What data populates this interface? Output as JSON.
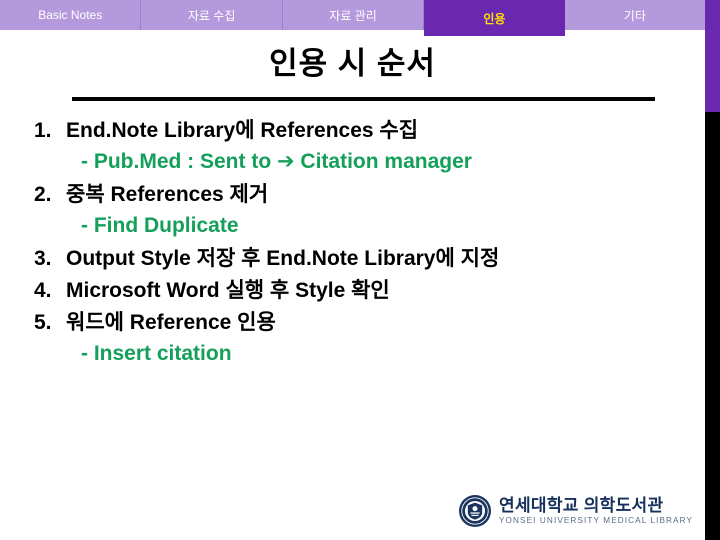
{
  "navbar": {
    "tabs": [
      {
        "label": "Basic Notes",
        "active": false
      },
      {
        "label": "자료 수집",
        "active": false
      },
      {
        "label": "자료 관리",
        "active": false
      },
      {
        "label": "인용",
        "active": true
      },
      {
        "label": "기타",
        "active": false
      }
    ],
    "background_color": "#b49add",
    "active_background_color": "#6a28b0",
    "active_text_color": "#ffe000",
    "text_color": "#ffffff"
  },
  "title": {
    "text": "인용 시 순서"
  },
  "content": {
    "items": [
      {
        "number": "1.",
        "text": "End.Note Library에 References 수집",
        "sub": "- Pub.Med : Sent to ➔ Citation manager"
      },
      {
        "number": "2.",
        "text": "중복 References 제거",
        "sub": "- Find Duplicate"
      },
      {
        "number": "3.",
        "text": "Output Style 저장 후 End.Note Library에 지정",
        "sub": ""
      },
      {
        "number": "4.",
        "text": "Microsoft Word 실행 후 Style 확인",
        "sub": ""
      },
      {
        "number": "5.",
        "text": "워드에 Reference 인용",
        "sub": "- Insert citation"
      }
    ],
    "sub_color": "#14a05a",
    "main_color": "#000000"
  },
  "footer": {
    "logo_korean": "연세대학교 의학도서관",
    "logo_english": "YONSEI UNIVERSITY MEDICAL LIBRARY",
    "logo_color": "#16305c"
  },
  "decor": {
    "edge_accent_color": "#6a28b0",
    "edge_lower_color": "#000000"
  }
}
